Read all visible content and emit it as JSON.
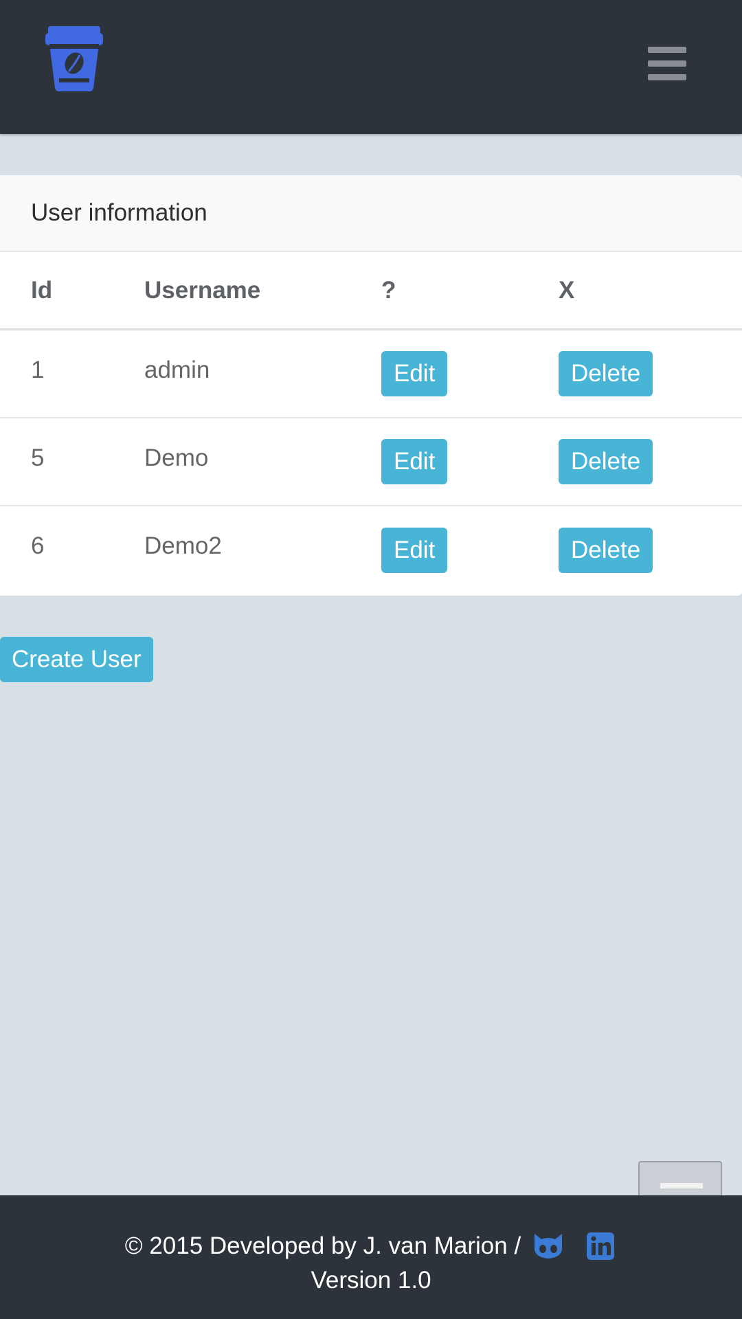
{
  "navbar": {
    "logo_icon": "coffee-cup-icon",
    "menu_icon": "hamburger-menu-icon",
    "background": "#2d333b",
    "logo_color": "#4169e1"
  },
  "panel": {
    "title": "User information",
    "columns": [
      "Id",
      "Username",
      "?",
      "X"
    ],
    "rows": [
      {
        "id": "1",
        "username": "admin",
        "edit": "Edit",
        "delete": "Delete"
      },
      {
        "id": "5",
        "username": "Demo",
        "edit": "Edit",
        "delete": "Delete"
      },
      {
        "id": "6",
        "username": "Demo2",
        "edit": "Edit",
        "delete": "Delete"
      }
    ]
  },
  "actions": {
    "create_user": "Create User",
    "button_color": "#48b5d6"
  },
  "footer": {
    "line1": "© 2015 Developed by J. van Marion /",
    "line2": "Version 1.0",
    "github_icon": "github-octocat-icon",
    "linkedin_icon": "linkedin-icon"
  },
  "scroll_button_icon": "scroll-lines-icon"
}
